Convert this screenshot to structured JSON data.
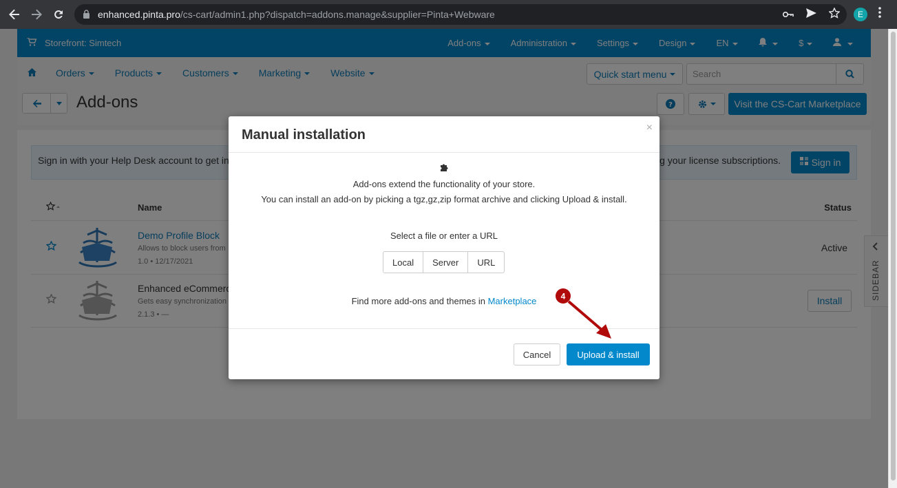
{
  "browser": {
    "url_host": "enhanced.pinta.pro",
    "url_path": "/cs-cart/admin1.php?dispatch=addons.manage&supplier=Pinta+Webware",
    "profile_initial": "E"
  },
  "topbar": {
    "storefront": "Storefront: Simtech",
    "menus": [
      "Add-ons",
      "Administration",
      "Settings",
      "Design",
      "EN",
      "$"
    ]
  },
  "navbar": {
    "items": [
      "Orders",
      "Products",
      "Customers",
      "Marketing",
      "Website"
    ],
    "quick_start": "Quick start menu",
    "search_placeholder": "Search"
  },
  "titlebar": {
    "title": "Add-ons",
    "help": "?",
    "marketplace_button": "Visit the CS-Cart Marketplace"
  },
  "notice": {
    "text_left": "Sign in with your Help Desk account to get infor",
    "text_right": "ong your license subscriptions.",
    "signin": "Sign in"
  },
  "table": {
    "col_name": "Name",
    "col_status": "Status",
    "rows": [
      {
        "name": "Demo Profile Block",
        "desc": "Allows to block users from",
        "meta": "1.0 • 12/17/2021",
        "status": "Active"
      },
      {
        "name": "Enhanced eCommerce",
        "desc": "Gets easy synchronization",
        "meta": "2.1.3 • —",
        "action": "Install"
      }
    ]
  },
  "sidebar_tab": "SIDEBAR",
  "modal": {
    "title": "Manual installation",
    "close": "×",
    "line1": "Add-ons extend the functionality of your store.",
    "line2": "You can install an add-on by picking a tgz,gz,zip format archive and clicking Upload & install.",
    "select_label": "Select a file or enter a URL",
    "sources": [
      "Local",
      "Server",
      "URL"
    ],
    "more_text": "Find more add-ons and themes in ",
    "more_link": "Marketplace",
    "cancel": "Cancel",
    "upload": "Upload & install"
  },
  "annotation": {
    "step": "4",
    "color": "#b10a0a"
  },
  "colors": {
    "brand": "#0388cc",
    "chrome": "#35363a"
  }
}
